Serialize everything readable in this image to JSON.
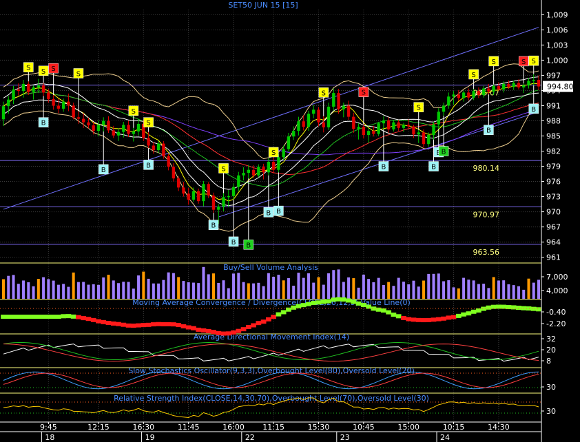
{
  "chart_data": {
    "type": "candlestick",
    "title": "SET50 JUN 15  [15]",
    "colors": {
      "background": "#000000",
      "grid": "#3a3a3a",
      "axis": "#ffffff",
      "bull": "#00c800",
      "bear": "#e00000",
      "title": "#4a8cff",
      "panel_label": "#4a8cff",
      "level_line": "#7b68ee",
      "level_text": "#ffff80",
      "last_price_bg": "#ffffff",
      "buy_sig": "#9ff3f6",
      "sell_sig": "#ffff00",
      "sell_sig_strong": "#ff2020",
      "volume_bar": "#a080ff",
      "volume_hi": "#ff9a00",
      "macd_up": "#80ff20",
      "macd_down": "#ff1a1a"
    },
    "price_axis": {
      "ticks": [
        "1,009",
        "1,006",
        "1,003",
        "1,000",
        "997",
        "994",
        "991",
        "988",
        "985",
        "982",
        "979",
        "976",
        "973",
        "970",
        "967",
        "964",
        "961"
      ],
      "ylim": [
        960,
        1010
      ],
      "last_price": "994.80"
    },
    "levels": [
      {
        "label": "995.07",
        "value": 995.07
      },
      {
        "label": "980.14",
        "value": 980.14
      },
      {
        "label": "970.97",
        "value": 970.97
      },
      {
        "label": "963.56",
        "value": 963.56
      }
    ],
    "trend_channel": {
      "upper": [
        {
          "x": 0,
          "y": 970.5
        },
        {
          "x": 154,
          "y": 1006.5
        }
      ],
      "lower": [
        {
          "x": 62,
          "y": 969.0
        },
        {
          "x": 154,
          "y": 989.8
        }
      ]
    },
    "candles": [
      {
        "o": 988.3,
        "h": 991.8,
        "l": 987.0,
        "c": 990.9
      },
      {
        "o": 990.9,
        "h": 992.9,
        "l": 989.4,
        "c": 992.2
      },
      {
        "o": 992.2,
        "h": 994.9,
        "l": 991.3,
        "c": 994.2
      },
      {
        "o": 994.2,
        "h": 995.4,
        "l": 993.0,
        "c": 993.9
      },
      {
        "o": 993.9,
        "h": 996.1,
        "l": 992.6,
        "c": 995.3
      },
      {
        "o": 995.3,
        "h": 995.8,
        "l": 993.1,
        "c": 993.7
      },
      {
        "o": 993.7,
        "h": 995.0,
        "l": 992.2,
        "c": 994.6
      },
      {
        "o": 994.6,
        "h": 996.3,
        "l": 993.5,
        "c": 995.0
      },
      {
        "o": 995.0,
        "h": 995.5,
        "l": 992.9,
        "c": 993.6
      },
      {
        "o": 993.6,
        "h": 994.3,
        "l": 991.6,
        "c": 992.3
      },
      {
        "o": 992.3,
        "h": 993.1,
        "l": 990.2,
        "c": 991.0
      },
      {
        "o": 991.0,
        "h": 992.4,
        "l": 989.5,
        "c": 990.4
      },
      {
        "o": 990.4,
        "h": 992.4,
        "l": 989.8,
        "c": 991.8
      },
      {
        "o": 991.8,
        "h": 993.4,
        "l": 989.9,
        "c": 991.0
      },
      {
        "o": 991.0,
        "h": 991.6,
        "l": 988.3,
        "c": 988.7
      },
      {
        "o": 988.7,
        "h": 989.9,
        "l": 987.4,
        "c": 988.4
      },
      {
        "o": 988.4,
        "h": 989.5,
        "l": 986.6,
        "c": 987.7
      },
      {
        "o": 987.7,
        "h": 988.6,
        "l": 986.5,
        "c": 987.1
      },
      {
        "o": 987.1,
        "h": 987.8,
        "l": 985.3,
        "c": 986.0
      },
      {
        "o": 986.0,
        "h": 988.1,
        "l": 984.9,
        "c": 987.2
      },
      {
        "o": 987.2,
        "h": 988.7,
        "l": 985.9,
        "c": 988.0
      },
      {
        "o": 988.0,
        "h": 988.9,
        "l": 985.6,
        "c": 986.1
      },
      {
        "o": 986.1,
        "h": 987.0,
        "l": 984.6,
        "c": 985.1
      },
      {
        "o": 985.1,
        "h": 986.5,
        "l": 984.0,
        "c": 985.8
      },
      {
        "o": 985.8,
        "h": 987.8,
        "l": 984.7,
        "c": 987.2
      },
      {
        "o": 987.2,
        "h": 988.0,
        "l": 984.8,
        "c": 985.4
      },
      {
        "o": 985.4,
        "h": 986.6,
        "l": 983.9,
        "c": 985.9
      },
      {
        "o": 985.9,
        "h": 988.3,
        "l": 985.1,
        "c": 987.4
      },
      {
        "o": 987.4,
        "h": 988.1,
        "l": 984.0,
        "c": 984.6
      },
      {
        "o": 984.6,
        "h": 985.8,
        "l": 982.6,
        "c": 983.1
      },
      {
        "o": 983.1,
        "h": 983.8,
        "l": 981.5,
        "c": 982.2
      },
      {
        "o": 982.2,
        "h": 984.1,
        "l": 981.6,
        "c": 983.5
      },
      {
        "o": 983.5,
        "h": 984.0,
        "l": 980.5,
        "c": 981.0
      },
      {
        "o": 981.0,
        "h": 981.5,
        "l": 978.2,
        "c": 978.9
      },
      {
        "o": 978.9,
        "h": 979.6,
        "l": 976.0,
        "c": 976.6
      },
      {
        "o": 976.6,
        "h": 977.1,
        "l": 974.1,
        "c": 974.8
      },
      {
        "o": 974.8,
        "h": 975.9,
        "l": 973.0,
        "c": 973.6
      },
      {
        "o": 973.6,
        "h": 974.7,
        "l": 971.4,
        "c": 972.4
      },
      {
        "o": 972.4,
        "h": 974.8,
        "l": 972.0,
        "c": 974.1
      },
      {
        "o": 974.1,
        "h": 974.6,
        "l": 971.6,
        "c": 972.1
      },
      {
        "o": 972.1,
        "h": 976.1,
        "l": 971.1,
        "c": 975.5
      },
      {
        "o": 975.5,
        "h": 975.9,
        "l": 972.7,
        "c": 973.2
      },
      {
        "o": 973.2,
        "h": 973.8,
        "l": 969.8,
        "c": 970.4
      },
      {
        "o": 970.4,
        "h": 971.5,
        "l": 967.6,
        "c": 971.0
      },
      {
        "o": 971.0,
        "h": 973.7,
        "l": 970.1,
        "c": 972.9
      },
      {
        "o": 972.9,
        "h": 974.3,
        "l": 970.9,
        "c": 973.1
      },
      {
        "o": 973.1,
        "h": 975.6,
        "l": 972.4,
        "c": 974.9
      },
      {
        "o": 974.9,
        "h": 977.9,
        "l": 974.1,
        "c": 977.2
      },
      {
        "o": 977.2,
        "h": 978.8,
        "l": 976.2,
        "c": 977.7
      },
      {
        "o": 977.7,
        "h": 979.3,
        "l": 976.6,
        "c": 978.3
      },
      {
        "o": 978.3,
        "h": 979.2,
        "l": 976.7,
        "c": 977.2
      },
      {
        "o": 977.2,
        "h": 979.4,
        "l": 976.8,
        "c": 978.9
      },
      {
        "o": 978.9,
        "h": 979.5,
        "l": 976.4,
        "c": 977.8
      },
      {
        "o": 977.8,
        "h": 980.6,
        "l": 977.2,
        "c": 979.9
      },
      {
        "o": 979.9,
        "h": 980.8,
        "l": 977.6,
        "c": 978.3
      },
      {
        "o": 978.3,
        "h": 981.5,
        "l": 977.8,
        "c": 980.8
      },
      {
        "o": 980.8,
        "h": 983.1,
        "l": 980.2,
        "c": 982.4
      },
      {
        "o": 982.4,
        "h": 985.6,
        "l": 981.9,
        "c": 984.9
      },
      {
        "o": 984.9,
        "h": 986.9,
        "l": 984.2,
        "c": 986.0
      },
      {
        "o": 986.0,
        "h": 988.8,
        "l": 985.1,
        "c": 987.9
      },
      {
        "o": 987.9,
        "h": 989.1,
        "l": 986.1,
        "c": 986.8
      },
      {
        "o": 986.8,
        "h": 990.0,
        "l": 986.0,
        "c": 989.4
      },
      {
        "o": 989.4,
        "h": 991.1,
        "l": 988.5,
        "c": 990.2
      },
      {
        "o": 990.2,
        "h": 990.7,
        "l": 986.9,
        "c": 987.7
      },
      {
        "o": 987.7,
        "h": 988.9,
        "l": 985.7,
        "c": 986.7
      },
      {
        "o": 986.7,
        "h": 991.6,
        "l": 986.2,
        "c": 990.8
      },
      {
        "o": 990.8,
        "h": 994.4,
        "l": 990.0,
        "c": 993.5
      },
      {
        "o": 993.5,
        "h": 994.3,
        "l": 989.4,
        "c": 990.3
      },
      {
        "o": 990.3,
        "h": 991.6,
        "l": 988.7,
        "c": 991.0
      },
      {
        "o": 991.0,
        "h": 992.0,
        "l": 988.2,
        "c": 988.8
      },
      {
        "o": 988.8,
        "h": 989.6,
        "l": 985.6,
        "c": 986.4
      },
      {
        "o": 986.4,
        "h": 987.5,
        "l": 984.3,
        "c": 986.8
      },
      {
        "o": 986.8,
        "h": 987.3,
        "l": 984.5,
        "c": 985.2
      },
      {
        "o": 985.2,
        "h": 986.6,
        "l": 983.6,
        "c": 986.0
      },
      {
        "o": 986.0,
        "h": 987.0,
        "l": 984.9,
        "c": 985.4
      },
      {
        "o": 985.4,
        "h": 987.8,
        "l": 985.0,
        "c": 987.5
      },
      {
        "o": 987.5,
        "h": 988.9,
        "l": 986.3,
        "c": 988.1
      },
      {
        "o": 988.1,
        "h": 988.7,
        "l": 985.6,
        "c": 986.3
      },
      {
        "o": 986.3,
        "h": 988.2,
        "l": 985.9,
        "c": 987.7
      },
      {
        "o": 987.7,
        "h": 988.2,
        "l": 986.0,
        "c": 986.6
      },
      {
        "o": 986.6,
        "h": 987.6,
        "l": 985.8,
        "c": 987.2
      },
      {
        "o": 987.2,
        "h": 988.3,
        "l": 986.4,
        "c": 986.9
      },
      {
        "o": 986.9,
        "h": 987.2,
        "l": 984.6,
        "c": 985.3
      },
      {
        "o": 985.3,
        "h": 986.2,
        "l": 983.6,
        "c": 985.7
      },
      {
        "o": 985.7,
        "h": 986.3,
        "l": 982.7,
        "c": 983.4
      },
      {
        "o": 983.4,
        "h": 985.7,
        "l": 982.9,
        "c": 985.2
      },
      {
        "o": 985.2,
        "h": 987.8,
        "l": 984.3,
        "c": 987.3
      },
      {
        "o": 987.3,
        "h": 990.5,
        "l": 986.4,
        "c": 989.8
      },
      {
        "o": 989.8,
        "h": 991.6,
        "l": 989.0,
        "c": 991.0
      },
      {
        "o": 991.0,
        "h": 993.6,
        "l": 990.4,
        "c": 992.8
      },
      {
        "o": 992.8,
        "h": 993.9,
        "l": 991.2,
        "c": 993.2
      },
      {
        "o": 993.2,
        "h": 994.1,
        "l": 991.9,
        "c": 992.5
      },
      {
        "o": 992.5,
        "h": 994.0,
        "l": 991.8,
        "c": 993.6
      },
      {
        "o": 993.6,
        "h": 994.4,
        "l": 992.0,
        "c": 992.6
      },
      {
        "o": 992.6,
        "h": 994.3,
        "l": 992.1,
        "c": 993.9
      },
      {
        "o": 993.9,
        "h": 994.6,
        "l": 992.5,
        "c": 993.1
      },
      {
        "o": 993.1,
        "h": 994.9,
        "l": 992.6,
        "c": 994.4
      },
      {
        "o": 994.4,
        "h": 995.3,
        "l": 993.2,
        "c": 993.8
      },
      {
        "o": 993.8,
        "h": 995.2,
        "l": 993.1,
        "c": 994.9
      },
      {
        "o": 994.9,
        "h": 995.6,
        "l": 993.9,
        "c": 994.2
      },
      {
        "o": 994.2,
        "h": 995.8,
        "l": 993.6,
        "c": 995.3
      },
      {
        "o": 995.3,
        "h": 996.0,
        "l": 994.3,
        "c": 994.7
      },
      {
        "o": 994.7,
        "h": 995.9,
        "l": 994.1,
        "c": 995.5
      },
      {
        "o": 995.5,
        "h": 996.2,
        "l": 994.2,
        "c": 994.6
      },
      {
        "o": 994.6,
        "h": 995.4,
        "l": 993.5,
        "c": 995.0
      },
      {
        "o": 995.0,
        "h": 996.5,
        "l": 994.4,
        "c": 995.9
      },
      {
        "o": 995.9,
        "h": 997.2,
        "l": 995.0,
        "c": 996.1
      },
      {
        "o": 996.1,
        "h": 997.0,
        "l": 994.1,
        "c": 994.8
      }
    ],
    "signals": [
      {
        "i": 5,
        "type": "sell",
        "label": "S",
        "value": 998.6
      },
      {
        "i": 8,
        "type": "sell",
        "label": "S",
        "value": 997.9
      },
      {
        "i": 10,
        "type": "sell_strong",
        "label": "S",
        "value": 998.4
      },
      {
        "i": 15,
        "type": "sell",
        "label": "S",
        "value": 997.4
      },
      {
        "i": 8,
        "type": "buy",
        "label": "B",
        "value": 987.7
      },
      {
        "i": 20,
        "type": "buy",
        "label": "B",
        "value": 978.4
      },
      {
        "i": 26,
        "type": "sell",
        "label": "S",
        "value": 990.0
      },
      {
        "i": 29,
        "type": "sell",
        "label": "S",
        "value": 987.7
      },
      {
        "i": 29,
        "type": "buy",
        "label": "B",
        "value": 979.3
      },
      {
        "i": 42,
        "type": "buy",
        "label": "B",
        "value": 967.4
      },
      {
        "i": 44,
        "type": "sell",
        "label": "S",
        "value": 978.6
      },
      {
        "i": 46,
        "type": "buy",
        "label": "B",
        "value": 964.1
      },
      {
        "i": 49,
        "type": "buy_strong",
        "label": "B",
        "value": 963.5
      },
      {
        "i": 53,
        "type": "buy",
        "label": "B",
        "value": 969.9
      },
      {
        "i": 55,
        "type": "buy",
        "label": "B",
        "value": 970.2
      },
      {
        "i": 54,
        "type": "sell",
        "label": "S",
        "value": 981.8
      },
      {
        "i": 64,
        "type": "sell",
        "label": "S",
        "value": 993.6
      },
      {
        "i": 72,
        "type": "sell_strong",
        "label": "S",
        "value": 993.7
      },
      {
        "i": 76,
        "type": "buy",
        "label": "B",
        "value": 979.0
      },
      {
        "i": 83,
        "type": "sell",
        "label": "S",
        "value": 990.7
      },
      {
        "i": 86,
        "type": "buy",
        "label": "B",
        "value": 979.0
      },
      {
        "i": 87,
        "type": "buy",
        "label": "B",
        "value": 981.8
      },
      {
        "i": 88,
        "type": "buy_strong",
        "label": "B",
        "value": 982.0
      },
      {
        "i": 94,
        "type": "sell",
        "label": "S",
        "value": 997.2
      },
      {
        "i": 97,
        "type": "buy",
        "label": "B",
        "value": 986.2
      },
      {
        "i": 98,
        "type": "sell",
        "label": "S",
        "value": 999.8
      },
      {
        "i": 104,
        "type": "sell_strong",
        "label": "S",
        "value": 999.8
      },
      {
        "i": 106,
        "type": "sell",
        "label": "S",
        "value": 999.9
      },
      {
        "i": 106,
        "type": "buy",
        "label": "B",
        "value": 990.4
      }
    ],
    "x_axis": {
      "time_labels": [
        {
          "i": 9,
          "label": "9:45"
        },
        {
          "i": 19,
          "label": "12:15"
        },
        {
          "i": 28,
          "label": "16:30"
        },
        {
          "i": 37,
          "label": "11:45"
        },
        {
          "i": 46,
          "label": "16:00"
        },
        {
          "i": 54,
          "label": "11:15"
        },
        {
          "i": 63,
          "label": "15:30"
        },
        {
          "i": 72,
          "label": "10:45"
        },
        {
          "i": 81,
          "label": "15:00"
        },
        {
          "i": 90,
          "label": "10:15"
        },
        {
          "i": 99,
          "label": "14:30"
        }
      ],
      "date_labels": [
        {
          "i": 9,
          "label": "18"
        },
        {
          "i": 29,
          "label": "19"
        },
        {
          "i": 49,
          "label": "22"
        },
        {
          "i": 68,
          "label": "23"
        },
        {
          "i": 88,
          "label": "24"
        }
      ]
    },
    "panels": [
      {
        "id": "volume",
        "label": "Buy/Sell Volume Analysis",
        "ticks": [
          "7,000",
          "4,000"
        ]
      },
      {
        "id": "macd",
        "label": "Moving Average Convergence / Divergence(CLOSE,26,12,9),Value Line(0)",
        "ticks": [
          "-0.40",
          "-2.20"
        ]
      },
      {
        "id": "adx",
        "label": "Average Directional Movement Index(14)",
        "ticks": [
          "32",
          "20",
          "8"
        ]
      },
      {
        "id": "stoch",
        "label": "Slow Stochastics Oscillator(9,3,3),Overbought Level(80),Oversold Level(20)",
        "ticks": [
          "30"
        ]
      },
      {
        "id": "rsi",
        "label": "Relative Strength Index(CLOSE,14,30,70),Overbought Level(70),Oversold Level(30)",
        "ticks": [
          "30"
        ]
      }
    ]
  }
}
